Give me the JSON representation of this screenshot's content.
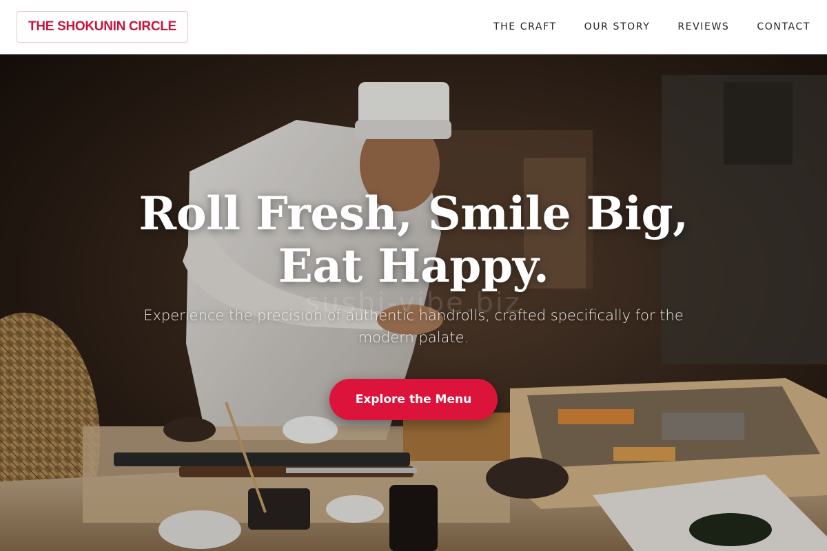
{
  "header": {
    "logo": "THE SHOKUNIN CIRCLE",
    "nav": [
      {
        "label": "THE CRAFT"
      },
      {
        "label": "OUR STORY"
      },
      {
        "label": "REVIEWS"
      },
      {
        "label": "CONTACT"
      }
    ]
  },
  "hero": {
    "title": "Roll Fresh, Smile Big, Eat Happy.",
    "subtitle": "Experience the precision of authentic handrolls, crafted specifically for the modern palate.",
    "cta_label": "Explore the Menu",
    "watermark": "sushi-vibe.biz"
  },
  "colors": {
    "accent": "#dc143c",
    "logo": "#c8143c",
    "header_bg": "#ffffff",
    "nav_text": "#222222"
  }
}
